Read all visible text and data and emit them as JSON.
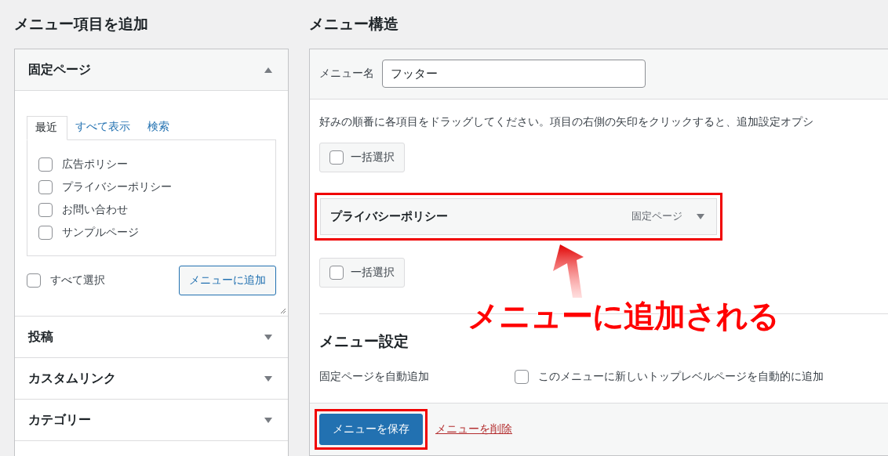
{
  "left": {
    "title": "メニュー項目を追加",
    "sections": [
      {
        "title": "固定ページ",
        "expanded": true,
        "tabs": [
          {
            "label": "最近",
            "selected": true
          },
          {
            "label": "すべて表示",
            "selected": false
          },
          {
            "label": "検索",
            "selected": false
          }
        ],
        "items": [
          {
            "label": "広告ポリシー",
            "checked": false
          },
          {
            "label": "プライバシーポリシー",
            "checked": false
          },
          {
            "label": "お問い合わせ",
            "checked": false
          },
          {
            "label": "サンプルページ",
            "checked": false
          }
        ],
        "select_all": {
          "label": "すべて選択",
          "checked": false
        },
        "add_button": "メニューに追加"
      },
      {
        "title": "投稿",
        "expanded": false
      },
      {
        "title": "カスタムリンク",
        "expanded": false
      },
      {
        "title": "カテゴリー",
        "expanded": false
      }
    ]
  },
  "right": {
    "title": "メニュー構造",
    "menu_name": {
      "label": "メニュー名",
      "value": "フッター"
    },
    "instructions": "好みの順番に各項目をドラッグしてください。項目の右側の矢印をクリックすると、追加設定オプシ",
    "bulk_select_top": {
      "label": "一括選択",
      "checked": false
    },
    "menu_items": [
      {
        "title": "プライバシーポリシー",
        "type": "固定ページ",
        "highlighted": true
      }
    ],
    "bulk_select_bottom": {
      "label": "一括選択",
      "checked": false
    },
    "settings": {
      "title": "メニュー設定",
      "rows": [
        {
          "label": "固定ページを自動追加",
          "option": "このメニューに新しいトップレベルページを自動的に追加",
          "checked": false
        }
      ]
    },
    "save_button": {
      "label": "メニューを保存",
      "highlighted": true
    },
    "delete_link": "メニューを削除"
  },
  "annotation": {
    "text": "メニューに追加される"
  }
}
